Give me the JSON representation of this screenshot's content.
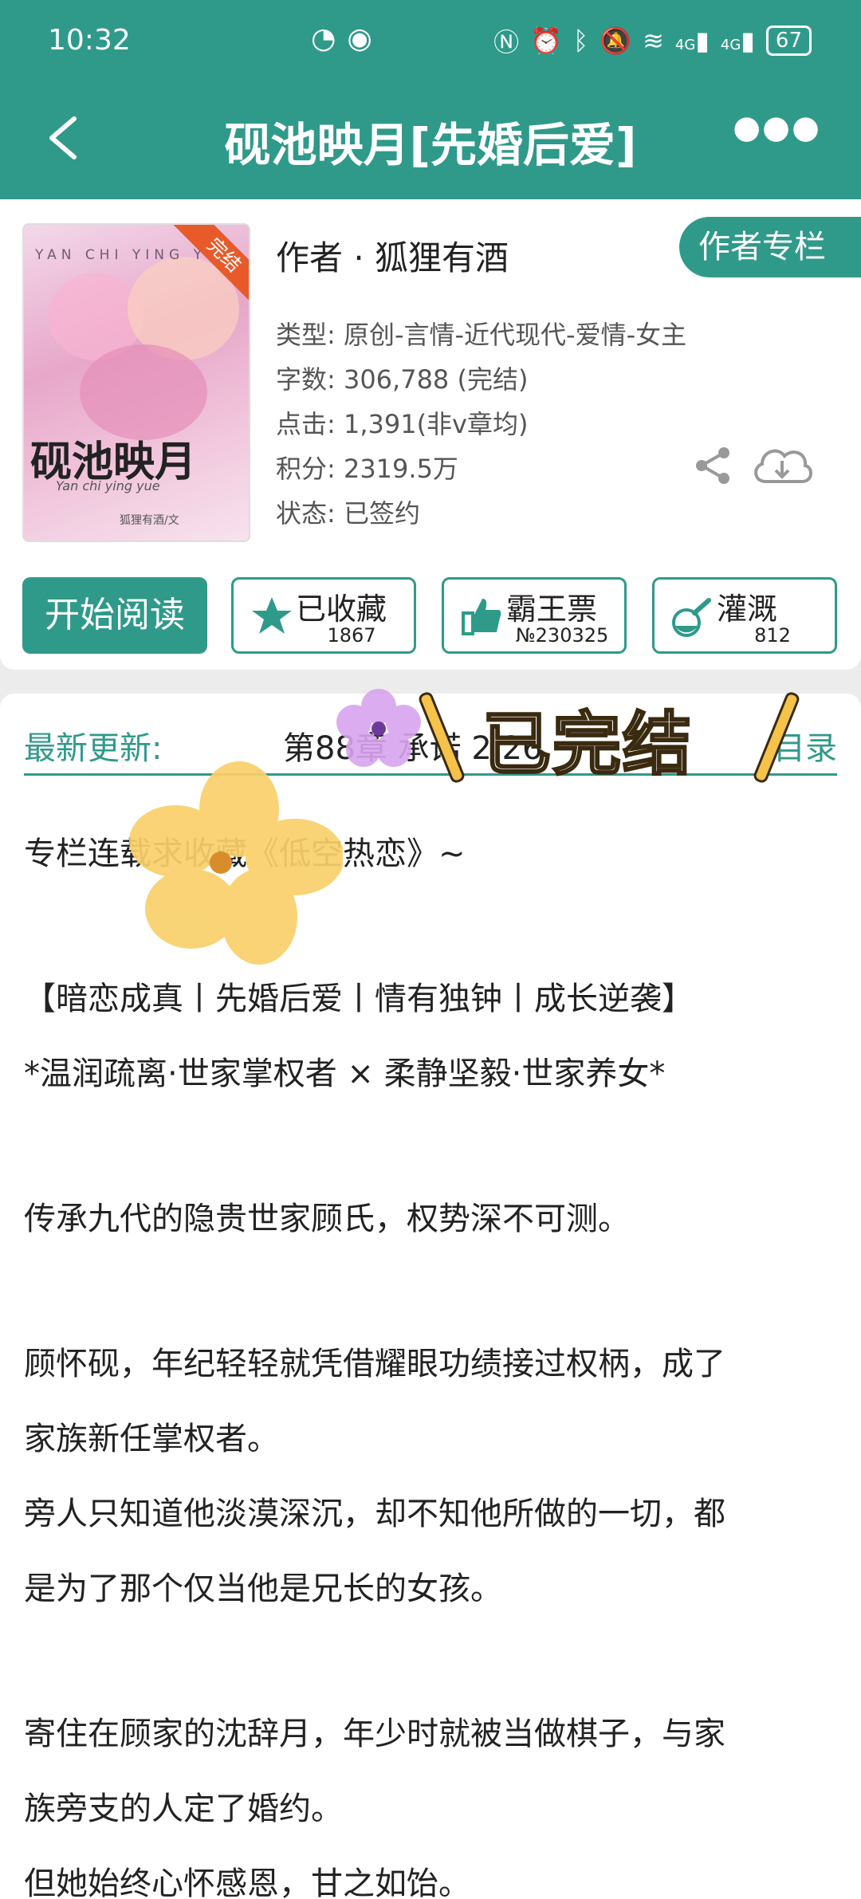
{
  "status_bar": {
    "time": "10:32",
    "battery": "67",
    "network_1": "4G",
    "network_2": "4G"
  },
  "nav": {
    "title": "砚池映月[先婚后爱]",
    "back_icon": "chevron-left-icon",
    "more_icon": "more-horizontal-icon"
  },
  "book": {
    "cover_topline": "YAN CHI YING Y",
    "cover_title": "砚池映月",
    "cover_subtitle": "Yan chi ying yue",
    "cover_author": "狐狸有酒/文",
    "ribbon": "完结",
    "author": "作者 · 狐狸有酒",
    "author_column": "作者专栏",
    "genre": "类型: 原创-言情-近代现代-爱情-女主",
    "words": "字数: 306,788 (完结)",
    "clicks": "点击: 1,391(非v章均)",
    "score": "积分: 2319.5万",
    "status": "状态: 已签约"
  },
  "actions": {
    "read": "开始阅读",
    "collect": {
      "label": "已收藏",
      "count": "1867",
      "icon": "star-icon"
    },
    "vote": {
      "label": "霸王票",
      "count": "№230325",
      "icon": "thumbs-up-icon"
    },
    "water": {
      "label": "灌溉",
      "count": "812",
      "icon": "flask-icon"
    }
  },
  "latest": {
    "label": "最新更新:",
    "chapter": "第88章 承诺 2.26",
    "toc": "目录"
  },
  "sticker": {
    "text": "已完结"
  },
  "content": [
    "专栏连载求收藏《低空热恋》~",
    "【暗恋成真丨先婚后爱丨情有独钟丨成长逆袭】",
    "*温润疏离·世家掌权者 × 柔静坚毅·世家养女*",
    "传承九代的隐贵世家顾氏，权势深不可测。",
    "顾怀砚，年纪轻轻就凭借耀眼功绩接过权柄，成了",
    "家族新任掌权者。",
    "旁人只知道他淡漠深沉，却不知他所做的一切，都",
    "是为了那个仅当他是兄长的女孩。",
    "寄住在顾家的沈辞月，年少时就被当做棋子，与家",
    "族旁支的人定了婚约。",
    "但她始终心怀感恩，甘之如饴。"
  ],
  "colors": {
    "brand": "#2f9a8a",
    "ribbon": "#e85a2a"
  }
}
